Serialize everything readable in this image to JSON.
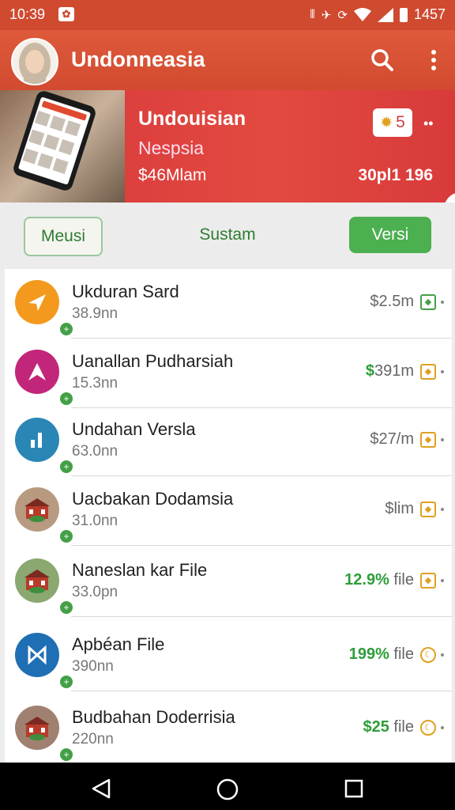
{
  "status_bar": {
    "time": "10:39",
    "battery_text": "1457"
  },
  "app_bar": {
    "title": "Undonneasia"
  },
  "banner": {
    "title": "Undouisian",
    "subtitle": "Nespsia",
    "amount": "$46Mlam",
    "badge_value": "5",
    "count_text": "30pl1 196"
  },
  "tabs": [
    {
      "label": "Meusi"
    },
    {
      "label": "Sustam"
    },
    {
      "label": "Versi"
    }
  ],
  "items": [
    {
      "name": "Ukduran Sard",
      "size": "38.9nn",
      "price": "$2.5m",
      "price_green": "",
      "icon_color": "#f39a1e",
      "icon": "send-icon",
      "status_color": "#43a047"
    },
    {
      "name": "Uanallan Pudharsiah",
      "size": "15.3nn",
      "price": "391m",
      "price_green": "$",
      "icon_color": "#c2267a",
      "icon": "arrow-icon",
      "status_color": "#e0a020"
    },
    {
      "name": "Undahan Versla",
      "size": "63.0nn",
      "price": "$27/m",
      "price_green": "",
      "icon_color": "#2a86b5",
      "icon": "chart-icon",
      "status_color": "#e0a020"
    },
    {
      "name": "Uacbakan Dodamsia",
      "size": "31.0nn",
      "price": "$lim",
      "price_green": "",
      "icon_color": "#b89a80",
      "icon": "building-icon",
      "status_color": "#e0a020"
    },
    {
      "name": "Naneslan kar File",
      "size": "33.0pn",
      "price": " file",
      "price_green": "12.9%",
      "icon_color": "#8aa870",
      "icon": "building-icon",
      "status_color": "#e0a020"
    },
    {
      "name": "Apbéan File",
      "size": "390nn",
      "price": " file",
      "price_green": "199%",
      "icon_color": "#1f6fb5",
      "icon": "bowtie-icon",
      "status_color": "#e0a020"
    },
    {
      "name": "Budbahan Doderrisia",
      "size": "220nn",
      "price": " file",
      "price_green": "$25",
      "icon_color": "#a08070",
      "icon": "building-icon",
      "status_color": "#e0a020"
    }
  ]
}
